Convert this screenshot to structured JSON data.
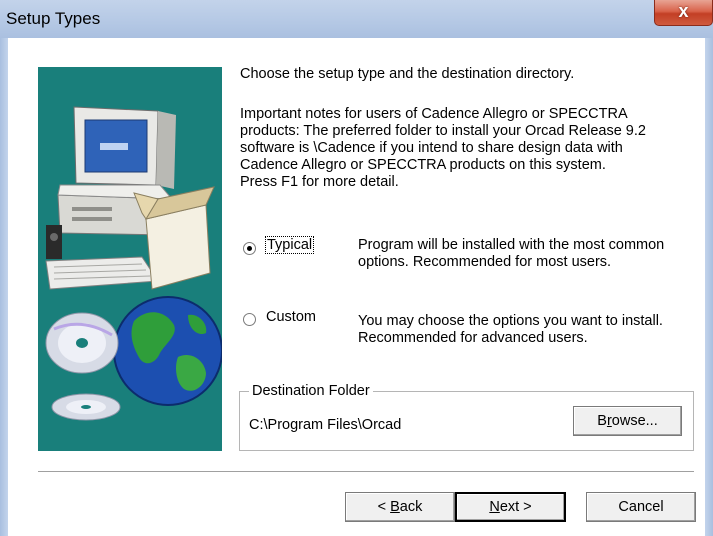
{
  "window": {
    "title": "Setup Types",
    "close_glyph": "x"
  },
  "main": {
    "intro": "Choose the setup type and the destination directory.",
    "notes": "Important notes for users of Cadence Allegro or SPECCTRA\nproducts:  The preferred folder to install your Orcad Release 9.2\nsoftware is \\Cadence if you intend to share design data with\nCadence Allegro or SPECCTRA products on this system.\nPress F1 for more detail."
  },
  "options": {
    "typical": {
      "label": "Typical",
      "selected": true,
      "description": "Program will be installed with the most common\noptions. Recommended for most users."
    },
    "custom": {
      "label": "Custom",
      "selected": false,
      "description": "You may choose the options you want to install.\nRecommended for advanced users."
    }
  },
  "destination": {
    "legend": "Destination Folder",
    "path": "C:\\Program Files\\Orcad",
    "browse_pre": "B",
    "browse_ul": "r",
    "browse_post": "owse..."
  },
  "buttons": {
    "back_pre": "< ",
    "back_ul": "B",
    "back_post": "ack",
    "next_ul": "N",
    "next_post": "ext >",
    "cancel": "Cancel"
  },
  "icons": [
    "close-icon",
    "computer-illustration",
    "globe-illustration",
    "cd-icon"
  ],
  "colors": {
    "art_background": "#197f7b",
    "titlebar": "#b8cbe6",
    "close_button": "#c94b31"
  }
}
